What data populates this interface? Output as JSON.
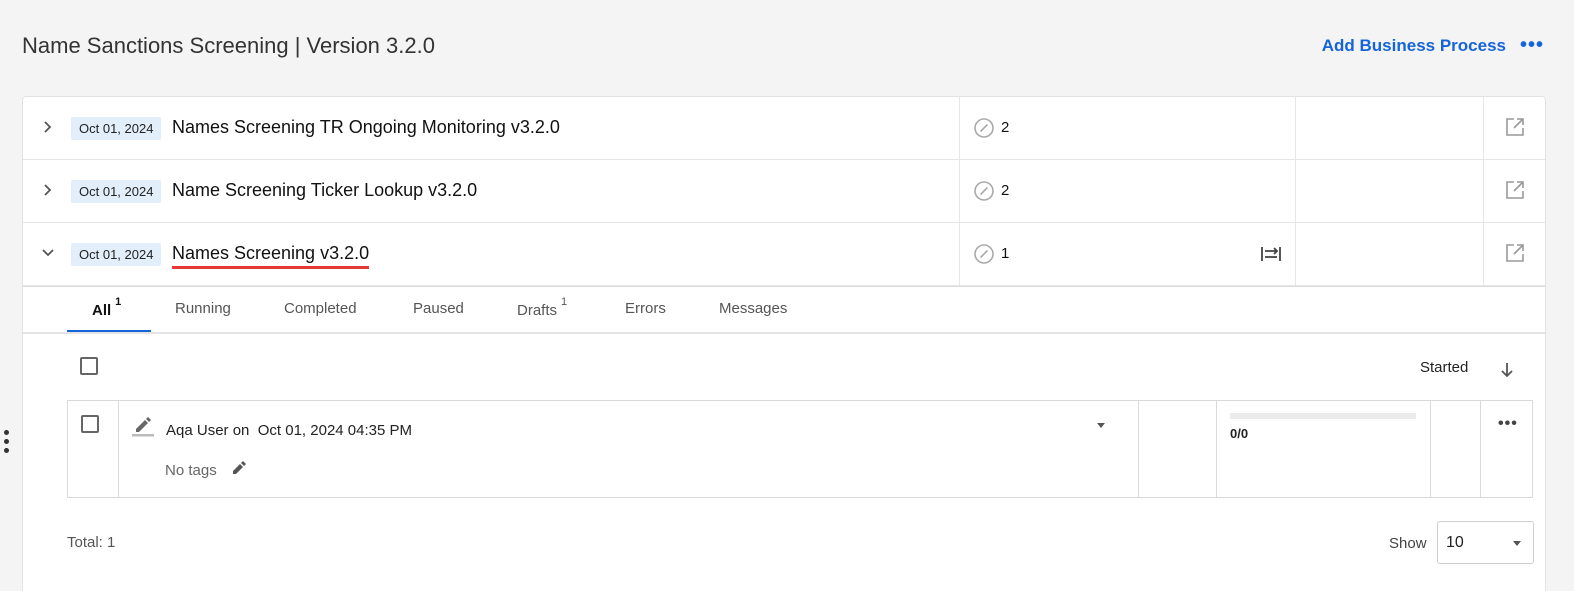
{
  "header": {
    "title": "Name Sanctions Screening | Version  3.2.0",
    "add_button": "Add Business Process",
    "more_icon": "more-horizontal-icon"
  },
  "processes": [
    {
      "date": "Oct 01, 2024",
      "name": "Names Screening TR Ongoing Monitoring  v3.2.0",
      "count": "2",
      "expanded": false
    },
    {
      "date": "Oct 01, 2024",
      "name": "Name Screening Ticker Lookup  v3.2.0",
      "count": "2",
      "expanded": false
    },
    {
      "date": "Oct 01, 2024",
      "name": "Names Screening  v3.2.0",
      "count": "1",
      "expanded": true
    }
  ],
  "tabs": [
    {
      "label": "All",
      "badge": "1",
      "active": true
    },
    {
      "label": "Running",
      "badge": ""
    },
    {
      "label": "Completed",
      "badge": ""
    },
    {
      "label": "Paused",
      "badge": ""
    },
    {
      "label": "Drafts",
      "badge": "1"
    },
    {
      "label": "Errors",
      "badge": ""
    },
    {
      "label": "Messages",
      "badge": ""
    }
  ],
  "list": {
    "sort_label": "Started",
    "instance": {
      "user": "Aqa User on",
      "timestamp": "Oct 01, 2024 04:35 PM",
      "tags": "No tags",
      "progress_text": "0/0",
      "progress_fraction": 0
    },
    "total": "Total: 1",
    "show_label": "Show",
    "page_size": "10"
  },
  "colors": {
    "accent": "#1565d8",
    "active_underline": "#e53935",
    "date_badge_bg": "#e3eefb"
  }
}
